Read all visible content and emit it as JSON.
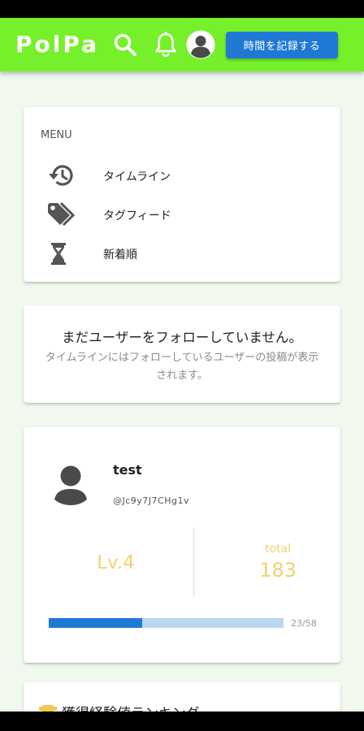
{
  "header": {
    "logo": "PolPa",
    "record_button": "時間を記録する",
    "brand_color": "#76f02a",
    "accent_color": "#1f78d4"
  },
  "icons": {
    "search": "search-icon",
    "notifications": "bell-icon",
    "account": "account-circle-icon"
  },
  "menu": {
    "heading": "MENU",
    "items": [
      {
        "label": "タイムライン",
        "icon": "history-icon"
      },
      {
        "label": "タグフィード",
        "icon": "tags-icon"
      },
      {
        "label": "新着順",
        "icon": "hourglass-icon"
      }
    ]
  },
  "follow_notice": {
    "title": "まだユーザーをフォローしていません。",
    "description": "タイムラインにはフォローしているユーザーの投稿が表示されます。"
  },
  "profile": {
    "username": "test",
    "user_id": "@Jc9y7J7CHg1v",
    "level": "Lv.4",
    "total_label": "total",
    "total_value": "183",
    "progress_text": "23/58",
    "progress_current": 23,
    "progress_max": 58,
    "stat_color": "#f2d270"
  },
  "ranking": {
    "title": "獲得経験値ランキング",
    "icon": "trophy-icon"
  }
}
